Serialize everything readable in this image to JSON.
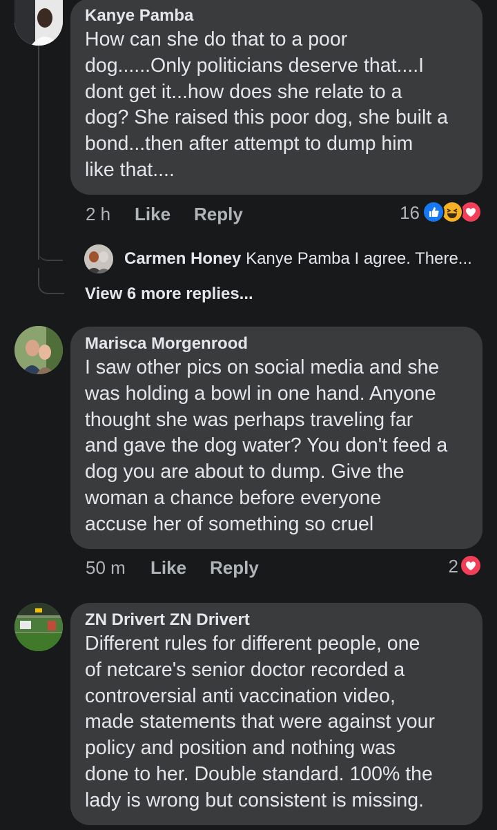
{
  "comments": [
    {
      "author": "Kanye Pamba",
      "lines": [
        "How can she do that to a poor",
        "dog......Only politicians deserve that....I",
        "dont get it...how does she relate to a",
        "dog? She raised this poor dog, she built a",
        "bond...then after attempt to dump him",
        "like that...."
      ],
      "time": "2 h",
      "like_label": "Like",
      "reply_label": "Reply",
      "reaction_count": "16",
      "reactions": [
        "like-icon",
        "haha-icon",
        "love-icon"
      ]
    },
    {
      "author": "Marisca Morgenrood",
      "lines": [
        "I saw other pics on social media and she",
        "was holding a bowl in one hand. Anyone",
        "thought she was perhaps traveling far",
        "and gave the dog water? You don't feed a",
        "dog you are about to dump. Give the",
        "woman a chance before everyone",
        "accuse her of something so cruel"
      ],
      "time": "50 m",
      "like_label": "Like",
      "reply_label": "Reply",
      "reaction_count": "2",
      "reactions": [
        "love-icon"
      ]
    },
    {
      "author": "ZN Drivert ZN Drivert",
      "lines": [
        "Different rules for different people, one",
        "of netcare's senior doctor recorded a",
        "controversial anti vaccination video,",
        "made statements that were against your",
        "policy and position and nothing was",
        "done to her. Double standard. 100% the",
        "lady is wrong but consistent is missing."
      ]
    }
  ],
  "reply_preview": {
    "author": "Carmen Honey",
    "text": "Kanye Pamba I agree. There..."
  },
  "view_more_label": "View 6 more replies...",
  "colors": {
    "background": "#18191a",
    "bubble": "#3a3b3c",
    "like_blue": "#1877f2",
    "haha_yellow": "#f7b125",
    "love_red": "#f33e58"
  }
}
